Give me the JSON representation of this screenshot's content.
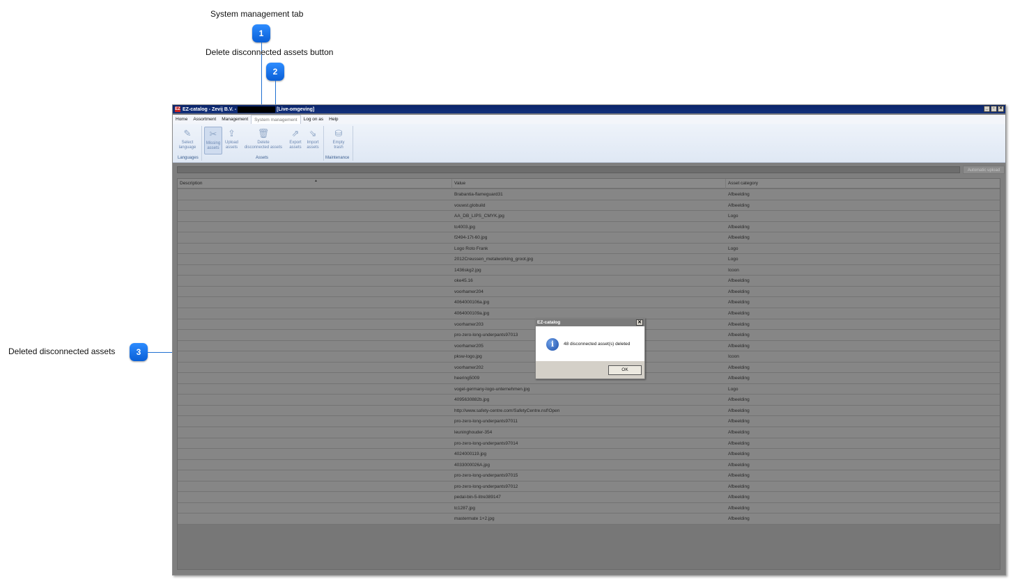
{
  "callouts": [
    {
      "number": "1",
      "label": "System management tab"
    },
    {
      "number": "2",
      "label": "Delete disconnected assets button"
    },
    {
      "number": "3",
      "label": "Deleted disconnected assets"
    }
  ],
  "window": {
    "title_prefix": "EZ-catalog - Zevij B.V. -",
    "title_suffix": "[Live-omgeving]",
    "app_icon": "EZ",
    "controls": {
      "minimize": "_",
      "restore": "▫",
      "close": "✕"
    }
  },
  "menu": {
    "items": [
      "Home",
      "Assortment",
      "Management",
      "System management",
      "Log on as",
      "Help"
    ],
    "active": "System management"
  },
  "ribbon": {
    "buttons": [
      {
        "label_1": "Select",
        "label_2": "language",
        "icon": "language-icon"
      },
      {
        "label_1": "Missing",
        "label_2": "assets",
        "icon": "missing-assets-icon"
      },
      {
        "label_1": "Upload",
        "label_2": "assets",
        "icon": "upload-icon"
      },
      {
        "label_1": "Delete",
        "label_2": "disconnected assets",
        "icon": "delete-icon"
      },
      {
        "label_1": "Export",
        "label_2": "assets",
        "icon": "export-icon"
      },
      {
        "label_1": "Import",
        "label_2": "assets",
        "icon": "import-icon"
      },
      {
        "label_1": "Empty",
        "label_2": "trash",
        "icon": "trash-icon"
      }
    ],
    "groups": [
      "Languages",
      "Assets",
      "Maintenance"
    ]
  },
  "toolbar": {
    "auto_upload_label": "Automatic upload"
  },
  "table": {
    "columns": [
      "Description",
      "Value",
      "Asset category"
    ],
    "rows": [
      {
        "description": "",
        "value": "Brabantia-flameguard31",
        "category": "Afbeelding"
      },
      {
        "description": "",
        "value": "vouwst.globuild",
        "category": "Afbeelding"
      },
      {
        "description": "",
        "value": "AA_DB_LIPS_CMYK.jpg",
        "category": "Logo"
      },
      {
        "description": "",
        "value": "tc4003.jpg",
        "category": "Afbeelding"
      },
      {
        "description": "",
        "value": "f2494-17t-60.jpg",
        "category": "Afbeelding"
      },
      {
        "description": "",
        "value": "Logo Roto Frank",
        "category": "Logo"
      },
      {
        "description": "",
        "value": "2012Creussen_metalworking_groot.jpg",
        "category": "Logo"
      },
      {
        "description": "",
        "value": "1436skg2.jpg",
        "category": "Icoon"
      },
      {
        "description": "",
        "value": "oke45.16",
        "category": "Afbeelding"
      },
      {
        "description": "",
        "value": "voorhamer204",
        "category": "Afbeelding"
      },
      {
        "description": "",
        "value": "4064000106a.jpg",
        "category": "Afbeelding"
      },
      {
        "description": "",
        "value": "4064000109a.jpg",
        "category": "Afbeelding"
      },
      {
        "description": "",
        "value": "voorhamer203",
        "category": "Afbeelding"
      },
      {
        "description": "",
        "value": "pro-zero-long-underpants97013",
        "category": "Afbeelding"
      },
      {
        "description": "",
        "value": "voorhamer205",
        "category": "Afbeelding"
      },
      {
        "description": "",
        "value": "pksw-logo.jpg",
        "category": "Icoon"
      },
      {
        "description": "",
        "value": "voorhamer202",
        "category": "Afbeelding"
      },
      {
        "description": "",
        "value": "heering5009",
        "category": "Afbeelding"
      },
      {
        "description": "",
        "value": "vogel-germany-logo-unternehmen.jpg",
        "category": "Logo"
      },
      {
        "description": "",
        "value": "4095630882b.jpg",
        "category": "Afbeelding"
      },
      {
        "description": "",
        "value": "http://www.safety-centre.com/SafetyCentre.nsf!Open",
        "category": "Afbeelding"
      },
      {
        "description": "",
        "value": "pro-zero-long-underpants97011",
        "category": "Afbeelding"
      },
      {
        "description": "",
        "value": "leuninghouder-354",
        "category": "Afbeelding"
      },
      {
        "description": "",
        "value": "pro-zero-long-underpants97014",
        "category": "Afbeelding"
      },
      {
        "description": "",
        "value": "4024000119.jpg",
        "category": "Afbeelding"
      },
      {
        "description": "",
        "value": "4033000026A.jpg",
        "category": "Afbeelding"
      },
      {
        "description": "",
        "value": "pro-zero-long-underpants97015",
        "category": "Afbeelding"
      },
      {
        "description": "",
        "value": "pro-zero-long-underpants97012",
        "category": "Afbeelding"
      },
      {
        "description": "",
        "value": "pedal-bin-5-litre389147",
        "category": "Afbeelding"
      },
      {
        "description": "",
        "value": "tc1287.jpg",
        "category": "Afbeelding"
      },
      {
        "description": "",
        "value": "mastermate 1+2.jpg",
        "category": "Afbeelding"
      }
    ]
  },
  "dialog": {
    "title": "EZ-catalog",
    "message": "48 disconnected asset(s) deleted",
    "ok_label": "OK",
    "close_glyph": "✕",
    "icon": "i"
  }
}
